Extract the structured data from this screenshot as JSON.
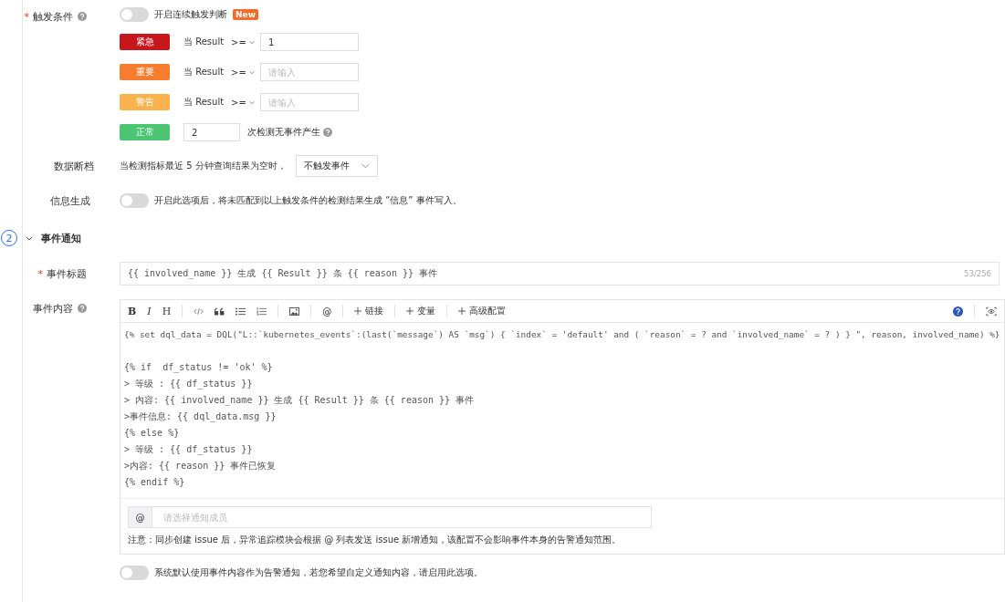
{
  "trigger": {
    "label": "触发条件",
    "required_mark": "*",
    "toggle": {
      "on": false,
      "label": "开启连续触发判断"
    },
    "badge": "New",
    "levels": [
      {
        "kind": "threshold",
        "label": "紧急",
        "color": "#c8161d",
        "condition": "当 Result",
        "operator": ">=",
        "value": "1"
      },
      {
        "kind": "threshold",
        "label": "重要",
        "color": "#f67c30",
        "condition": "当 Result",
        "operator": ">=",
        "placeholder": "请输入"
      },
      {
        "kind": "threshold",
        "label": "警告",
        "color": "#fbb24c",
        "condition": "当 Result",
        "operator": ">=",
        "placeholder": "请输入"
      },
      {
        "kind": "count",
        "label": "正常",
        "color": "#4cc572",
        "value": "2",
        "suffix": "次检测无事件产生"
      }
    ]
  },
  "data_gap": {
    "label": "数据断档",
    "text": "当检测指标最近 5 分钟查询结果为空时，",
    "select": "不触发事件"
  },
  "info": {
    "label": "信息生成",
    "toggle": {
      "on": false,
      "label": "开启此选项后，将未匹配到以上触发条件的检测结果生成 “信息” 事件写入。"
    }
  },
  "section": {
    "number": "2",
    "title": "事件通知",
    "expanded": true
  },
  "event_title": {
    "label": "事件标题",
    "required_mark": "*",
    "value": "{{ involved_name }} 生成 {{ Result }} 条 {{ reason }} 事件",
    "count": "53/256"
  },
  "event_content": {
    "label": "事件内容",
    "format_buttons": [
      "B",
      "I",
      "H"
    ],
    "at_button": "@",
    "actions": [
      "链接",
      "变量",
      "高级配置"
    ],
    "code_blocks": [
      [
        "{% set dql_data = DQL(\"L::`kubernetes_events`:(last(`message`) AS `msg`) { `index` = 'default' and ( `reason` = ? and `involved_name` = ? ) } \", reason, involved_name) %}"
      ],
      [
        "{% if  df_status != 'ok' %}",
        "> 等级 : {{ df_status }}",
        "> 内容: {{ involved_name }} 生成 {{ Result }} 条 {{ reason }} 事件",
        ">事件信息: {{ dql_data.msg }}",
        "{% else %}",
        "> 等级 : {{ df_status }}",
        ">内容: {{ reason }} 事件已恢复",
        "{% endif %}"
      ]
    ],
    "mention": {
      "symbol": "@",
      "placeholder": "请选择通知成员"
    },
    "note": "注意：同步创建 issue 后，异常追踪模块会根据 @ 列表发送 issue 新增通知，该配置不会影响事件本身的告警通知范围。"
  },
  "custom_notice": {
    "on": false,
    "label": "系统默认使用事件内容作为告警通知，若您希望自定义通知内容，请启用此选项。"
  }
}
